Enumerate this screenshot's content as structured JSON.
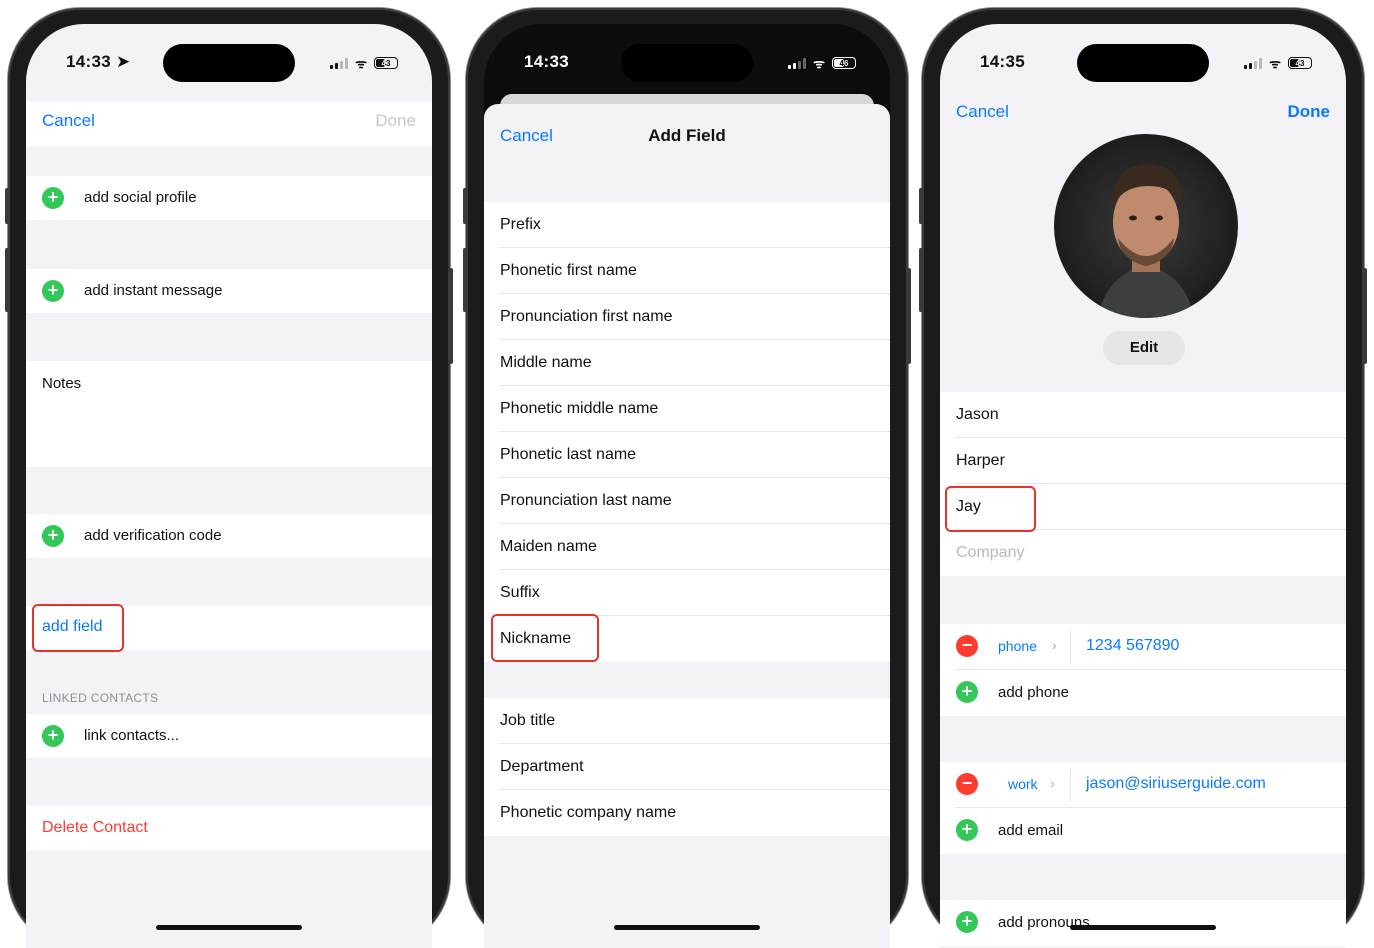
{
  "phone1": {
    "status": {
      "time": "14:33",
      "battery": "43"
    },
    "nav": {
      "cancel": "Cancel",
      "done": "Done"
    },
    "items": {
      "social": "add social profile",
      "instant": "add instant message",
      "notes": "Notes",
      "verification": "add verification code",
      "add_field": "add field",
      "linked_header": "LINKED CONTACTS",
      "link": "link contacts...",
      "delete": "Delete Contact"
    }
  },
  "phone2": {
    "status": {
      "time": "14:33",
      "battery": "46"
    },
    "nav": {
      "cancel": "Cancel",
      "title": "Add Field"
    },
    "fields": [
      "Prefix",
      "Phonetic first name",
      "Pronunciation first name",
      "Middle name",
      "Phonetic middle name",
      "Phonetic last name",
      "Pronunciation last name",
      "Maiden name",
      "Suffix",
      "Nickname"
    ],
    "fields2": [
      "Job title",
      "Department",
      "Phonetic company name"
    ]
  },
  "phone3": {
    "status": {
      "time": "14:35",
      "battery": "43"
    },
    "nav": {
      "cancel": "Cancel",
      "done": "Done"
    },
    "edit": "Edit",
    "first": "Jason",
    "last": "Harper",
    "nickname": "Jay",
    "company_placeholder": "Company",
    "phone": {
      "label": "phone",
      "value": "1234 567890",
      "add": "add phone"
    },
    "email": {
      "label": "work",
      "value": "jason@siriuserguide.com",
      "add": "add email"
    },
    "pronouns": "add pronouns"
  },
  "colors": {
    "accent": "#0a7aff",
    "add": "#34c759",
    "delete": "#ff3b30",
    "highlight": "#e0352b"
  }
}
